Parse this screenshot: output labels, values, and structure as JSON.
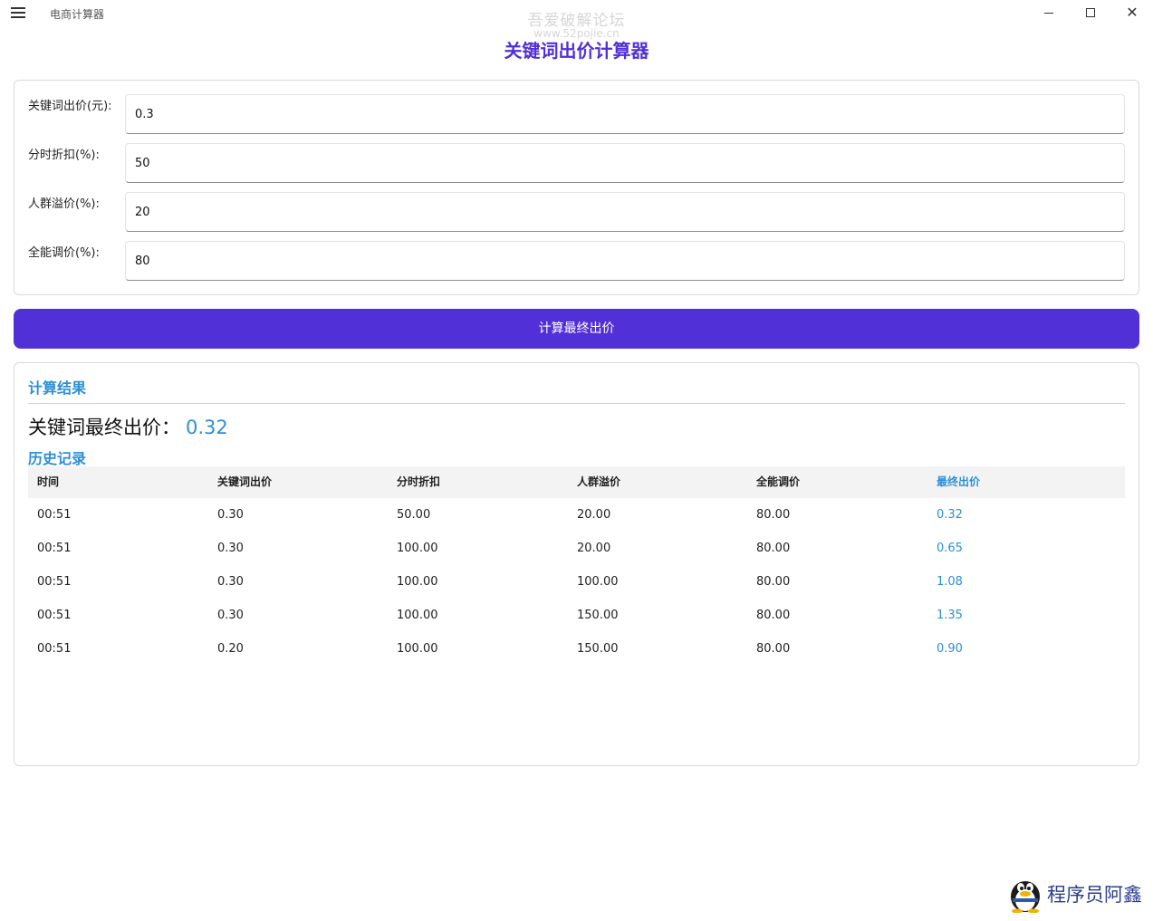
{
  "window": {
    "app_name": "电商计算器",
    "close_glyph": "✕"
  },
  "watermark": {
    "line1": "吾爱破解论坛",
    "line2": "www.52pojie.cn"
  },
  "page": {
    "title": "关键词出价计算器"
  },
  "inputs": [
    {
      "label": "关键词出价(元):",
      "value": "0.3"
    },
    {
      "label": "分时折扣(%):",
      "value": "50"
    },
    {
      "label": "人群溢价(%):",
      "value": "20"
    },
    {
      "label": "全能调价(%):",
      "value": "80"
    }
  ],
  "calc_button": {
    "label": "计算最终出价"
  },
  "result": {
    "heading": "计算结果",
    "final_label": "关键词最终出价：",
    "final_value": "0.32"
  },
  "history": {
    "heading": "历史记录",
    "columns": [
      "时间",
      "关键词出价",
      "分时折扣",
      "人群溢价",
      "全能调价",
      "最终出价"
    ],
    "rows": [
      [
        "00:51",
        "0.30",
        "50.00",
        "20.00",
        "80.00",
        "0.32"
      ],
      [
        "00:51",
        "0.30",
        "100.00",
        "20.00",
        "80.00",
        "0.65"
      ],
      [
        "00:51",
        "0.30",
        "100.00",
        "100.00",
        "80.00",
        "1.08"
      ],
      [
        "00:51",
        "0.30",
        "100.00",
        "150.00",
        "80.00",
        "1.35"
      ],
      [
        "00:51",
        "0.20",
        "100.00",
        "150.00",
        "80.00",
        "0.90"
      ]
    ]
  },
  "brand": {
    "label": "程序员阿鑫",
    "icon": "penguin-icon"
  },
  "colors": {
    "accent": "#5230d8",
    "result_blue": "#2d8fd6"
  }
}
